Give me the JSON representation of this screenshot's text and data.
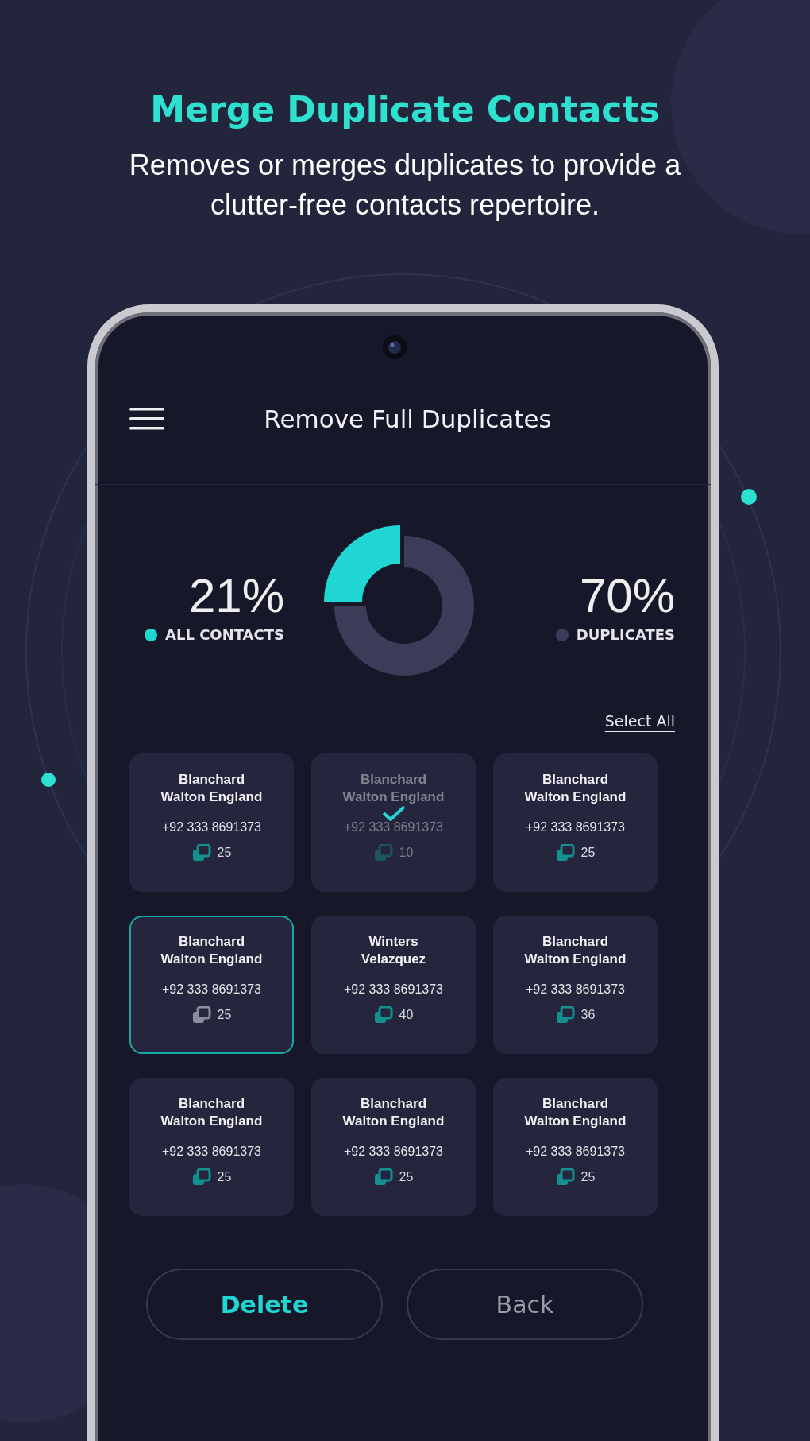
{
  "promo": {
    "headline": "Merge Duplicate Contacts",
    "subtitle": "Removes or merges duplicates to provide a clutter-free contacts repertoire."
  },
  "screen": {
    "title": "Remove Full Duplicates",
    "stats": [
      {
        "value": "21%",
        "label": "ALL CONTACTS",
        "color": "#1fd6d2"
      },
      {
        "value": "70%",
        "label": "DUPLICATES",
        "color": "#3a3c58"
      }
    ],
    "select_all": "Select All",
    "contacts": [
      {
        "name": "Blanchard Walton England",
        "phone": "+92 333 8691373",
        "count": "25",
        "selected": false,
        "checked": false
      },
      {
        "name": "Blanchard Walton England",
        "phone": "+92 333 8691373",
        "count": "10",
        "selected": false,
        "checked": true
      },
      {
        "name": "Blanchard Walton England",
        "phone": "+92 333 8691373",
        "count": "25",
        "selected": false,
        "checked": false
      },
      {
        "name": "Blanchard Walton England",
        "phone": "+92 333 8691373",
        "count": "25",
        "selected": true,
        "checked": false
      },
      {
        "name": "Winters Velazquez",
        "phone": "+92 333 8691373",
        "count": "40",
        "selected": false,
        "checked": false
      },
      {
        "name": "Blanchard Walton England",
        "phone": "+92 333 8691373",
        "count": "36",
        "selected": false,
        "checked": false
      },
      {
        "name": "Blanchard Walton England",
        "phone": "+92 333 8691373",
        "count": "25",
        "selected": false,
        "checked": false
      },
      {
        "name": "Blanchard Walton England",
        "phone": "+92 333 8691373",
        "count": "25",
        "selected": false,
        "checked": false
      },
      {
        "name": "Blanchard Walton England",
        "phone": "+92 333 8691373",
        "count": "25",
        "selected": false,
        "checked": false
      }
    ],
    "buttons": [
      {
        "label": "Delete",
        "kind": "primary"
      },
      {
        "label": "Back",
        "kind": "secondary"
      }
    ]
  }
}
